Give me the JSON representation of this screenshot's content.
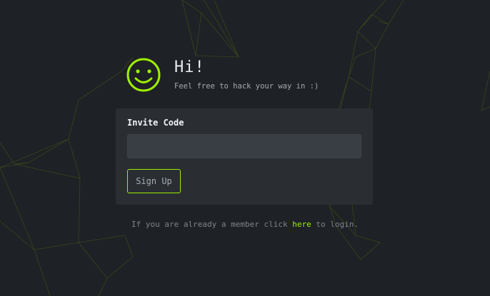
{
  "hero": {
    "title": "Hi!",
    "subtitle": "Feel free to hack your way in :)"
  },
  "form": {
    "invite_label": "Invite Code",
    "invite_value": "",
    "invite_placeholder": "",
    "signup_label": "Sign Up"
  },
  "footer": {
    "text_before": "If you are already a member click ",
    "link_text": "here",
    "text_after": " to login."
  },
  "icons": {
    "smiley": "smiley-icon"
  },
  "colors": {
    "background": "#1e2125",
    "card": "#2a2e33",
    "input": "#393e44",
    "accent": "#9fef00",
    "network_line": "#556b1a"
  }
}
